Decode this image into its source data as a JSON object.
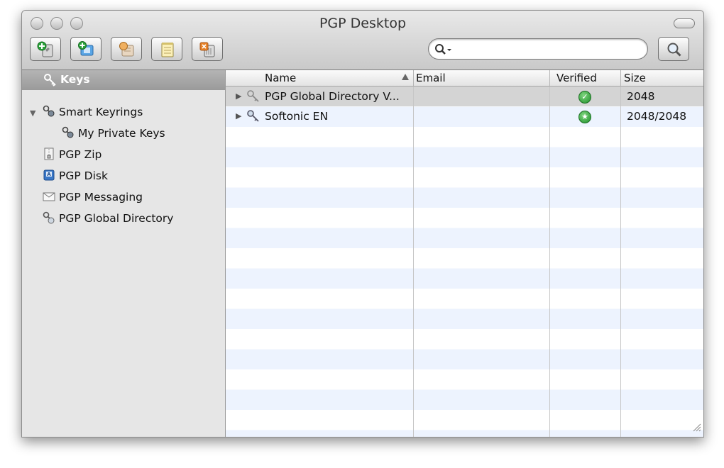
{
  "window": {
    "title": "PGP Desktop"
  },
  "toolbar": {
    "buttons": [
      {
        "icon": "new-key-icon"
      },
      {
        "icon": "add-key-icon"
      },
      {
        "icon": "export-key-icon"
      },
      {
        "icon": "properties-notepad-icon"
      },
      {
        "icon": "delete-key-icon"
      }
    ]
  },
  "search": {
    "value": "",
    "placeholder": ""
  },
  "sidebar": {
    "items": [
      {
        "label": "Keys",
        "icon": "keys-icon",
        "selected": true
      },
      {
        "label": "Smart Keyrings",
        "icon": "smart-keyring-icon",
        "expanded": true
      },
      {
        "label": "My Private Keys",
        "icon": "private-keys-icon"
      },
      {
        "label": "PGP Zip",
        "icon": "zip-icon"
      },
      {
        "label": "PGP Disk",
        "icon": "disk-icon"
      },
      {
        "label": "PGP Messaging",
        "icon": "messaging-icon"
      },
      {
        "label": "PGP Global Directory",
        "icon": "global-directory-icon"
      }
    ]
  },
  "table": {
    "columns": [
      "Name",
      "Email",
      "Verified",
      "Size"
    ],
    "sort_column": "Name",
    "rows": [
      {
        "name": "PGP Global Directory V...",
        "email": "",
        "verified": "checkmark",
        "size": "2048",
        "selected": true
      },
      {
        "name": "Softonic EN",
        "email": "",
        "verified": "star",
        "size": "2048/2048",
        "selected": false
      }
    ]
  },
  "colors": {
    "verified_green": "#1f8f2a",
    "selection_gray": "#d4d4d4",
    "stripe_blue": "#edf3fe"
  }
}
